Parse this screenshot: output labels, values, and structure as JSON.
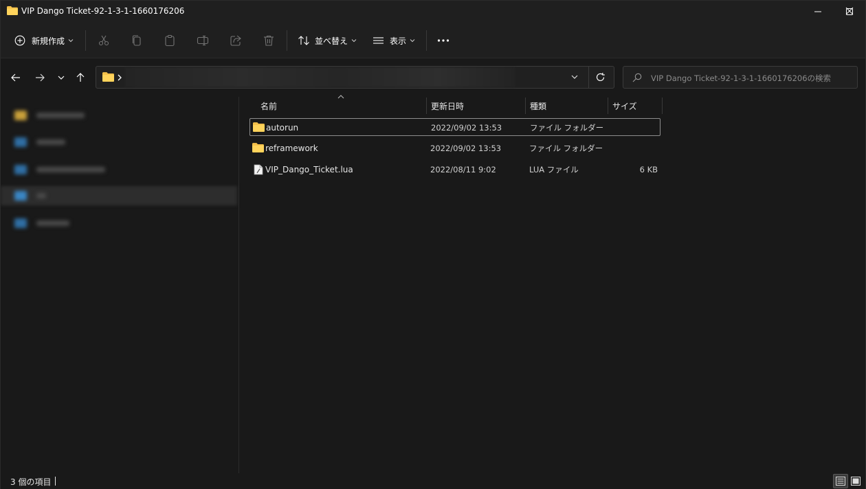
{
  "window": {
    "title": "VIP Dango Ticket-92-1-3-1-1660176206"
  },
  "toolbar": {
    "new_label": "新規作成",
    "sort_label": "並べ替え",
    "view_label": "表示"
  },
  "search": {
    "placeholder": "VIP Dango Ticket-92-1-3-1-1660176206の検索"
  },
  "columns": {
    "name": "名前",
    "modified": "更新日時",
    "type": "種類",
    "size": "サイズ"
  },
  "files": [
    {
      "name": "autorun",
      "modified": "2022/09/02 13:53",
      "type": "ファイル フォルダー",
      "size": "",
      "icon": "folder-icon"
    },
    {
      "name": "reframework",
      "modified": "2022/09/02 13:53",
      "type": "ファイル フォルダー",
      "size": "",
      "icon": "folder-icon"
    },
    {
      "name": "VIP_Dango_Ticket.lua",
      "modified": "2022/08/11 9:02",
      "type": "LUA ファイル",
      "size": "6 KB",
      "icon": "lua-file-icon"
    }
  ],
  "status": {
    "item_count": "3 個の項目"
  },
  "colors": {
    "folder": "#f4c04a",
    "background": "#191919",
    "toolbar": "#1f1f1f"
  }
}
